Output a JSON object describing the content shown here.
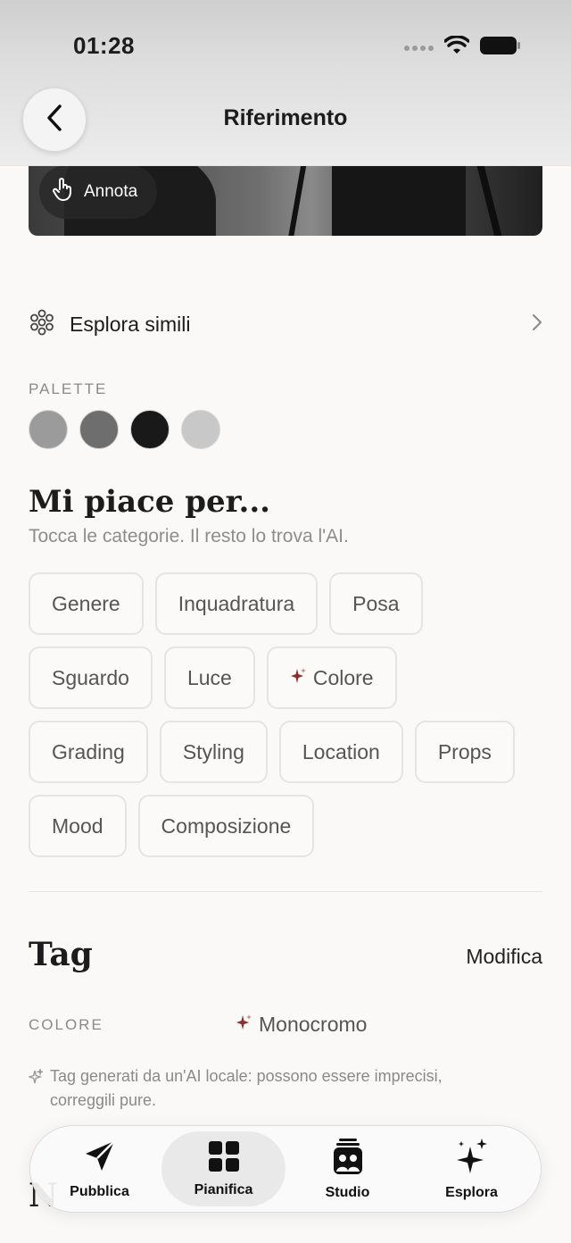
{
  "status_bar": {
    "time": "01:28"
  },
  "nav": {
    "title": "Riferimento",
    "back_icon": "chevron-left-icon"
  },
  "hero": {
    "annotate_label": "Annota",
    "annotate_icon": "hand-pointer-icon"
  },
  "explore": {
    "label": "Esplora simili",
    "icon": "flower-grid-icon"
  },
  "palette": {
    "label": "PALETTE",
    "colors": [
      "#9b9b9b",
      "#6e6e6e",
      "#191919",
      "#c8c8c8"
    ]
  },
  "likes": {
    "title": "Mi piace per...",
    "subtitle": "Tocca le categorie. Il resto lo trova l'AI.",
    "chips": [
      [
        "Genere",
        "Inquadratura",
        "Posa"
      ],
      [
        "Sguardo",
        "Luce",
        "Colore"
      ],
      [
        "Grading",
        "Styling",
        "Location",
        "Props"
      ],
      [
        "Mood",
        "Composizione"
      ]
    ],
    "ai_chip": "Colore"
  },
  "tags": {
    "title": "Tag",
    "edit_label": "Modifica",
    "rows": [
      {
        "label": "COLORE",
        "value": "Monocromo"
      }
    ],
    "note": "Tag generati da un'AI locale: possono essere imprecisi, correggili pure."
  },
  "peek_heading": "N",
  "tabbar": {
    "tabs": [
      {
        "label": "Pubblica",
        "icon": "send-icon"
      },
      {
        "label": "Pianifica",
        "icon": "grid-icon"
      },
      {
        "label": "Studio",
        "icon": "studio-icon"
      },
      {
        "label": "Esplora",
        "icon": "sparkles-icon"
      }
    ],
    "active": "Pianifica"
  },
  "colors": {
    "background": "#faf9f7",
    "ai_accent": "#8b2e2e"
  }
}
